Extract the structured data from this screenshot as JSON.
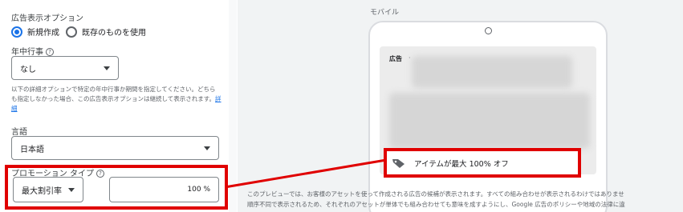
{
  "form": {
    "display_options_label": "広告表示オプション",
    "radio_new": "新規作成",
    "radio_existing": "既存のものを使用",
    "occasion_label": "年中行事",
    "occasion_value": "なし",
    "help_text": "以下の詳細オプションで特定の年中行事か期間を指定してください。どちらも指定しなかった場合、この広告表示オプションは継続して表示されます。",
    "help_link": "詳細",
    "language_label": "言語",
    "language_value": "日本語",
    "promotion_type_label": "プロモーション タイプ",
    "promotion_type_value": "最大割引率",
    "promotion_value": "100 %"
  },
  "preview": {
    "device_label": "モバイル",
    "ad_badge": "広告",
    "ad_dot": "·",
    "promo_text": "アイテムが最大 100% オフ",
    "note_line1": "このプレビューでは、お客様のアセットを使って作成される広告の候補が表示されます。すべての組み合わせが表示されるわけではありませ",
    "note_line2": "順序不同で表示されるため、それぞれのアセットが単体でも組み合わせても意味を成すようにし、Google 広告のポリシーや地域の法律に違"
  },
  "icons": {
    "help": "help-circle-icon",
    "tag": "tag-icon",
    "dropdown": "chevron-down-icon"
  },
  "colors": {
    "accent": "#1a73e8",
    "highlight": "#e00000",
    "background_panel": "#f1f3f4"
  }
}
